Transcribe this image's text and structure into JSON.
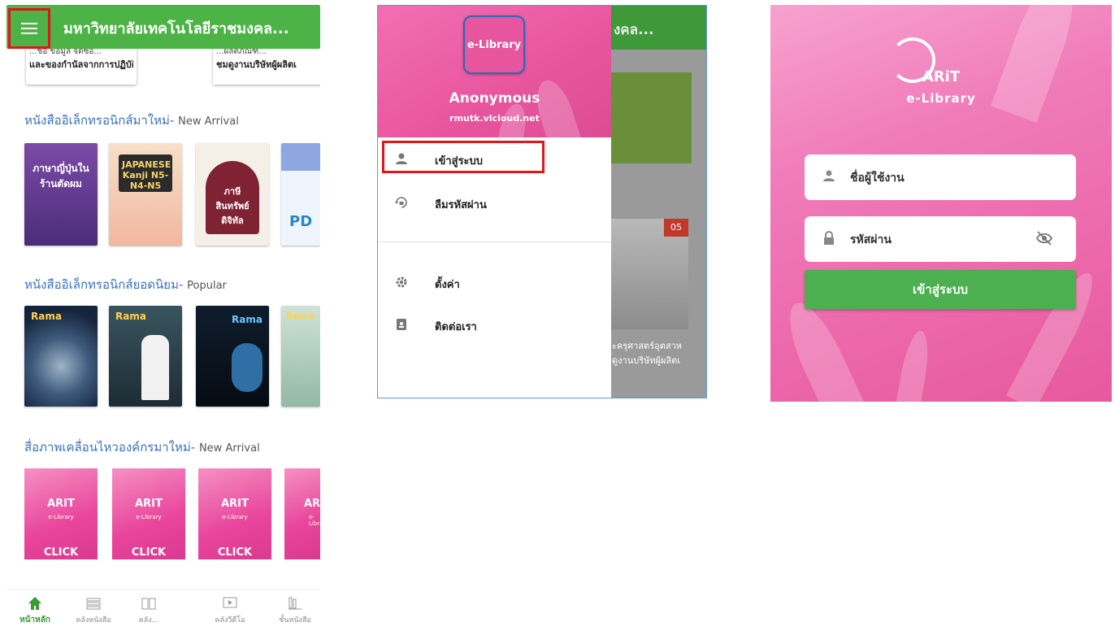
{
  "home": {
    "app_title": "มหาวิทยาลัยเทคโนโลยีราชมงคล...",
    "news_cards": [
      {
        "line1": "...ชื่อ ข้อมูล จัดซื้อ...",
        "line2": "และของกำนัลจากการปฏิบัติหน้าที่ (No"
      },
      {
        "line1": "...ผลิตภัณฑ์...",
        "line2": "ชมดูงานบริษัทผู้ผลิตเ"
      }
    ],
    "sections": [
      {
        "title": "หนังสืออิเล็กทรอนิกส์มาใหม่-",
        "title_en": "New Arrival"
      },
      {
        "title": "หนังสืออิเล็กทรอนิกส์ยอดนิยม-",
        "title_en": "Popular"
      },
      {
        "title": "สื่อภาพเคลื่อนไหวองค์กรมาใหม่-",
        "title_en": "New Arrival"
      }
    ],
    "new_books": [
      {
        "title": "ภาษาญี่ปุ่นในร้านตัดผม",
        "color": "#6a3a8e"
      },
      {
        "title": "JAPANESE Kanji N5-N4-N5",
        "color": "#f5c9b0"
      },
      {
        "title": "ภาษี สินทรัพย์ดิจิทัล",
        "color": "#8c2a38"
      },
      {
        "title": "PD",
        "color": "#eaf2fb"
      }
    ],
    "popular_books": [
      {
        "title": "Rama",
        "color": "#1b2e4a"
      },
      {
        "title": "Rama",
        "color": "#26404f"
      },
      {
        "title": "Rama",
        "color": "#0e1a2a"
      },
      {
        "title": "Rama",
        "color": "#b9d4c4"
      }
    ],
    "videos": [
      {
        "logo": "ARIT",
        "sub": "e-Library",
        "cta": "CLICK"
      },
      {
        "logo": "ARIT",
        "sub": "e-Library",
        "cta": "CLICK"
      },
      {
        "logo": "ARIT",
        "sub": "e-Library",
        "cta": "CLICK"
      },
      {
        "logo": "ARIT",
        "sub": "e-Library",
        "cta": ""
      }
    ],
    "bottom_nav": [
      {
        "label": "หน้าหลัก",
        "icon": "home-icon",
        "active": true
      },
      {
        "label": "คลังหนังสือ",
        "icon": "books-stack-icon",
        "active": false
      },
      {
        "label": "คลัง...",
        "icon": "open-book-icon",
        "active": false
      },
      {
        "label": "คลังวีดีโอ",
        "icon": "video-icon",
        "active": false
      },
      {
        "label": "ชั้นหนังสือ",
        "icon": "bookshelf-icon",
        "active": false
      }
    ]
  },
  "drawer": {
    "logo_text": "e-Library",
    "user_name": "Anonymous",
    "user_host": "rmutk.vlcloud.net",
    "items": [
      {
        "label": "เข้าสู่ระบบ",
        "icon": "person-icon"
      },
      {
        "label": "ลืมรหัสผ่าน",
        "icon": "reset-lock-icon"
      },
      {
        "label": "ตั้งค่า",
        "icon": "gear-icon"
      },
      {
        "label": "ติดต่อเรา",
        "icon": "contact-card-icon"
      }
    ],
    "background": {
      "title": "งคล...",
      "badge": "05",
      "text1": "ะครุศาสตร์อุตสาห",
      "text2": "ดูงานบริษัทผู้ผลิตเ"
    }
  },
  "login": {
    "brand": "ARiT",
    "brand_sub": "e-Library",
    "username_placeholder": "ชื่อผู้ใช้งาน",
    "password_placeholder": "รหัสผ่าน",
    "submit_label": "เข้าสู่ระบบ"
  },
  "colors": {
    "appbar_green": "#4db346",
    "pink": "#e8559f",
    "highlight_red": "#e0161b",
    "login_button": "#4caf50"
  }
}
